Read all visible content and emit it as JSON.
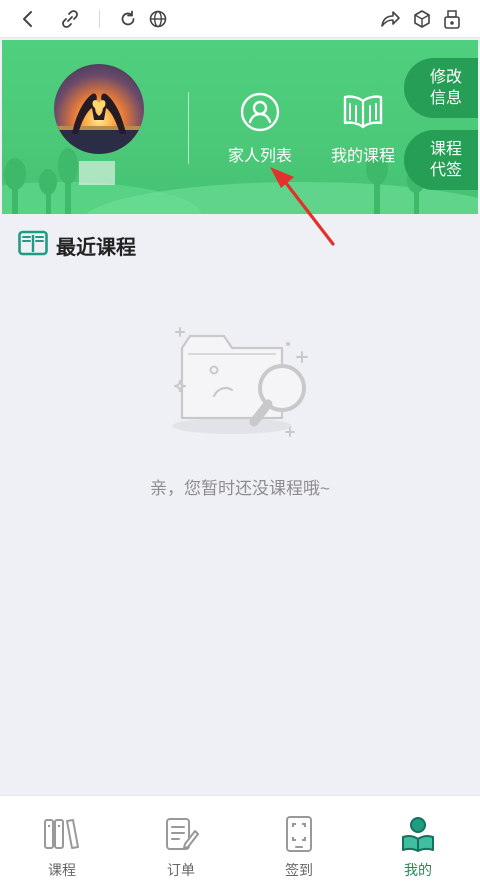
{
  "browser": {
    "icons": [
      "back-icon",
      "link-icon",
      "refresh-icon",
      "globe-icon",
      "share-icon",
      "cube-icon",
      "bookmark-icon"
    ]
  },
  "header": {
    "shortcuts": [
      {
        "label": "家人列表",
        "icon": "person-icon"
      },
      {
        "label": "我的课程",
        "icon": "open-book-icon"
      }
    ],
    "side_buttons": [
      {
        "label": "修改信息"
      },
      {
        "label": "课程代签"
      }
    ],
    "colors": {
      "primary": "#4bc878",
      "side_button": "#279e55"
    }
  },
  "section": {
    "title": "最近课程",
    "icon": "book-icon"
  },
  "empty_state": {
    "message": "亲，您暂时还没课程哦~",
    "illustration": "empty-folder-magnifier"
  },
  "tabbar": {
    "active_index": 3,
    "active_color": "#2a8a57",
    "tabs": [
      {
        "label": "课程",
        "icon": "courses-icon"
      },
      {
        "label": "订单",
        "icon": "orders-icon"
      },
      {
        "label": "签到",
        "icon": "checkin-icon"
      },
      {
        "label": "我的",
        "icon": "mine-icon"
      }
    ]
  }
}
